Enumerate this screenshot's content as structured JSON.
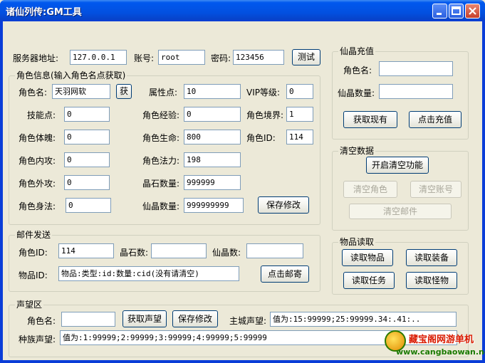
{
  "window": {
    "title": "诸仙列传:GM工具"
  },
  "server": {
    "address_label": "服务器地址:",
    "address_value": "127.0.0.1",
    "account_label": "账号:",
    "account_value": "root",
    "password_label": "密码:",
    "password_value": "123456",
    "test_button": "测试"
  },
  "role_info": {
    "title": "角色信息(输入角色名点获取)",
    "name_label": "角色名:",
    "name_value": "天羽网软",
    "fetch_button": "获",
    "attr_points_label": "属性点:",
    "attr_points_value": "10",
    "vip_label": "VIP等级:",
    "vip_value": "0",
    "skill_points_label": "技能点:",
    "skill_points_value": "0",
    "exp_label": "角色经验:",
    "exp_value": "0",
    "realm_label": "角色境界:",
    "realm_value": "1",
    "physique_label": "角色体魄:",
    "physique_value": "0",
    "hp_label": "角色生命:",
    "hp_value": "800",
    "role_id_label": "角色ID:",
    "role_id_value": "114",
    "inner_atk_label": "角色内攻:",
    "inner_atk_value": "0",
    "mana_label": "角色法力:",
    "mana_value": "198",
    "outer_atk_label": "角色外攻:",
    "outer_atk_value": "0",
    "crystal_label": "晶石数量:",
    "crystal_value": "999999",
    "body_art_label": "角色身法:",
    "body_art_value": "0",
    "xianjing_label": "仙晶数量:",
    "xianjing_value": "999999999",
    "save_button": "保存修改"
  },
  "recharge": {
    "title": "仙晶充值",
    "name_label": "角色名:",
    "name_value": "",
    "amount_label": "仙晶数量:",
    "amount_value": "",
    "get_button": "获取现有",
    "charge_button": "点击充值"
  },
  "clear": {
    "title": "清空数据",
    "enable_button": "开启清空功能",
    "clear_role_button": "清空角色",
    "clear_account_button": "清空账号",
    "clear_mail_button": "清空邮件"
  },
  "mail": {
    "title": "邮件发送",
    "role_id_label": "角色ID:",
    "role_id_value": "114",
    "crystal_label": "晶石数:",
    "crystal_value": "",
    "xianjing_label": "仙晶数:",
    "xianjing_value": "",
    "item_id_label": "物品ID:",
    "item_id_value": "物品:类型:id:数量:cid(没有请清空)",
    "send_button": "点击邮寄"
  },
  "items": {
    "title": "物品读取",
    "read_items": "读取物品",
    "read_equip": "读取装备",
    "read_tasks": "读取任务",
    "read_monsters": "读取怪物"
  },
  "reputation": {
    "title": "声望区",
    "name_label": "角色名:",
    "name_value": "",
    "get_button": "获取声望",
    "save_button": "保存修改",
    "city_label": "主城声望:",
    "city_value": "值为:15:99999;25:99999.34:.41:..",
    "race_label": "种族声望:",
    "race_value": "值为:1:99999;2:99999;3:99999;4:99999;5:99999"
  },
  "watermark": {
    "name": "藏宝阁网游单机",
    "url": "www.cangbaowan.net"
  }
}
